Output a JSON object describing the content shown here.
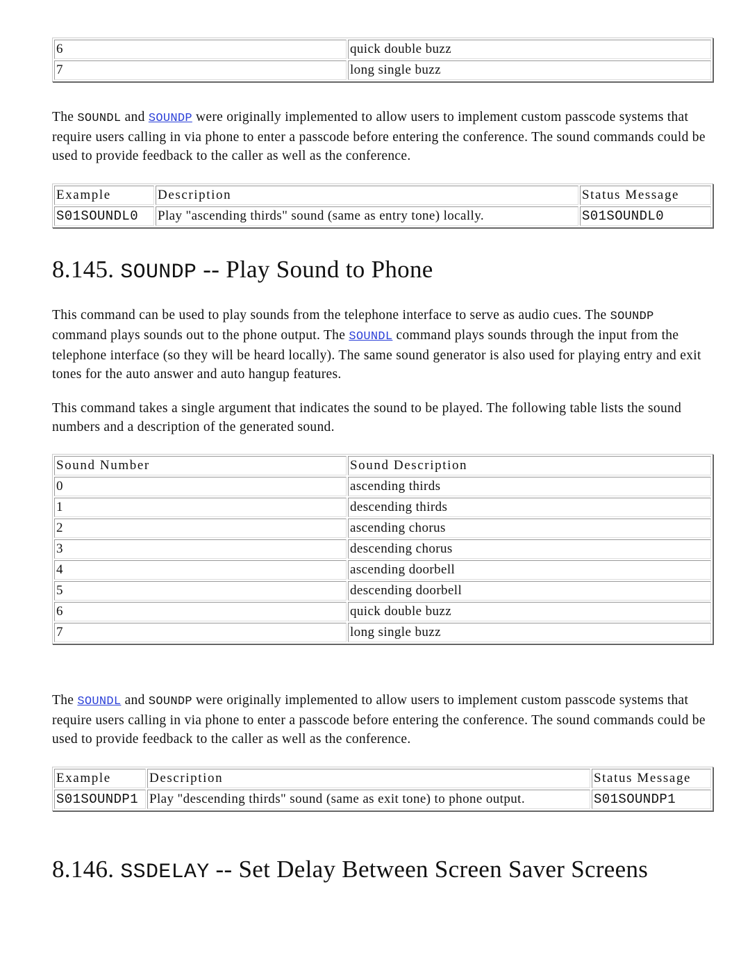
{
  "top_table": {
    "rows": [
      {
        "number": "6",
        "description": "quick double buzz"
      },
      {
        "number": "7",
        "description": "long single buzz"
      }
    ]
  },
  "intro_para_1": {
    "prefix": "The ",
    "cmd1": "SOUNDL",
    "mid": " and ",
    "cmd2_link": "SOUNDP",
    "rest": " were originally implemented to allow users to implement custom passcode systems that require users calling in via phone to enter a passcode before entering the conference. The sound commands could be used to provide feedback to the caller as well as the conference."
  },
  "example_table_1": {
    "headers": {
      "example": "Example",
      "description": "Description",
      "status": "Status Message"
    },
    "row": {
      "example": "S01SOUNDL0",
      "description": "Play \"ascending thirds\" sound (same as entry tone) locally.",
      "status": "S01SOUNDL0"
    }
  },
  "section_145": {
    "number": "8.145.",
    "command": "SOUNDP",
    "title": " -- Play Sound to Phone"
  },
  "soundp_para_1": {
    "part1": "This command can be used to play sounds from the telephone interface to serve as audio cues. The ",
    "cmd": "SOUNDP",
    "part2": " command plays sounds out to the phone output. The ",
    "link": "SOUNDL",
    "part3": " command plays sounds through the input from the telephone interface (so they will be heard locally). The same sound generator is also used for playing entry and exit tones for the auto answer and auto hangup features."
  },
  "soundp_para_2": "This command takes a single argument that indicates the sound to be played. The following table lists the sound numbers and a description of the generated sound.",
  "sound_table": {
    "headers": {
      "number": "Sound Number",
      "description": "Sound Description"
    },
    "rows": [
      {
        "number": "0",
        "description": "ascending thirds"
      },
      {
        "number": "1",
        "description": "descending thirds"
      },
      {
        "number": "2",
        "description": "ascending chorus"
      },
      {
        "number": "3",
        "description": "descending chorus"
      },
      {
        "number": "4",
        "description": "ascending doorbell"
      },
      {
        "number": "5",
        "description": "descending doorbell"
      },
      {
        "number": "6",
        "description": "quick double buzz"
      },
      {
        "number": "7",
        "description": "long single buzz"
      }
    ]
  },
  "soundp_para_3": {
    "prefix": "The ",
    "cmd1_link": "SOUNDL",
    "mid": " and ",
    "cmd2": "SOUNDP",
    "rest": " were originally implemented to allow users to implement custom passcode systems that require users calling in via phone to enter a passcode before entering the conference. The sound commands could be used to provide feedback to the caller as well as the conference."
  },
  "example_table_2": {
    "headers": {
      "example": "Example",
      "description": "Description",
      "status": "Status Message"
    },
    "row": {
      "example": "S01SOUNDP1",
      "description": "Play \"descending thirds\" sound (same as exit tone) to phone output.",
      "status": "S01SOUNDP1"
    }
  },
  "section_146": {
    "number": "8.146.",
    "command": "SSDELAY",
    "title": " -- Set Delay Between Screen Saver Screens"
  },
  "colors": {
    "link": "#2a3fd8",
    "text": "#111111"
  }
}
